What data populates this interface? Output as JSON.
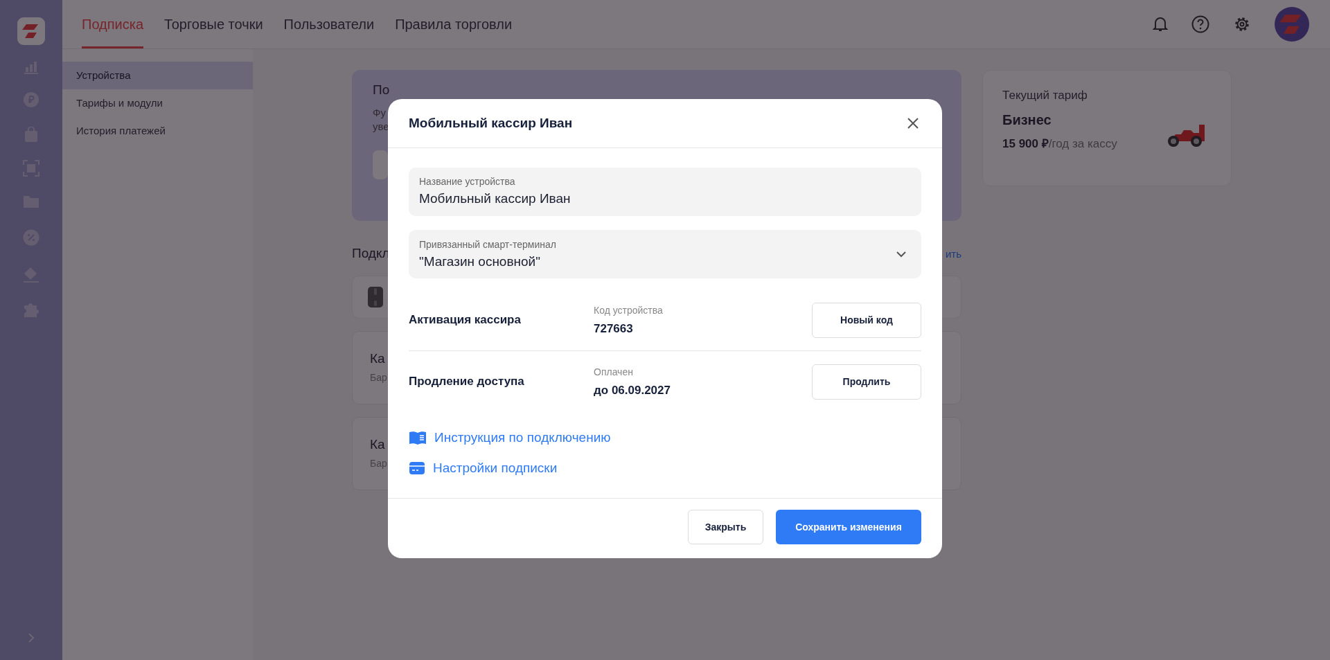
{
  "header": {
    "tabs": [
      {
        "label": "Подписка",
        "selected": true
      },
      {
        "label": "Торговые точки",
        "selected": false
      },
      {
        "label": "Пользователи",
        "selected": false
      },
      {
        "label": "Правила торговли",
        "selected": false
      }
    ]
  },
  "subnav": {
    "items": [
      {
        "label": "Устройства",
        "selected": true
      },
      {
        "label": "Тарифы и модули",
        "selected": false
      },
      {
        "label": "История платежей",
        "selected": false
      }
    ]
  },
  "background": {
    "promo_title": "По",
    "promo_text": [
      "Фу",
      "уве"
    ],
    "section_title": "Подкл",
    "section_link": "ить",
    "device_cards": [
      {
        "title": "Ка",
        "subtitle": "Бар"
      },
      {
        "title": "Ка",
        "subtitle": "Бар"
      }
    ]
  },
  "tariff_card": {
    "label": "Текущий тариф",
    "plan": "Бизнес",
    "price": "15 900 ₽",
    "period": "/год за кассу"
  },
  "modal": {
    "title": "Мобильный кассир Иван",
    "fields": [
      {
        "kind": "text",
        "label": "Название устройства",
        "value": "Мобильный кассир Иван"
      },
      {
        "kind": "select",
        "label": "Привязанный смарт-терминал",
        "value": "\"Магазин основной\""
      }
    ],
    "rows": [
      {
        "title": "Активация кассира",
        "caption": "Код устройства",
        "value": "727663",
        "button": "Новый код"
      },
      {
        "title": "Продление доступа",
        "caption": "Оплачен",
        "value": "до 06.09.2027",
        "button": "Продлить"
      }
    ],
    "links": [
      {
        "kind": "book",
        "label": "Инструкция по подключению"
      },
      {
        "kind": "card",
        "label": "Настройки подписки"
      }
    ],
    "buttons": [
      {
        "label": "Закрыть",
        "primary": false
      },
      {
        "label": "Сохранить изменения",
        "primary": true
      }
    ]
  }
}
